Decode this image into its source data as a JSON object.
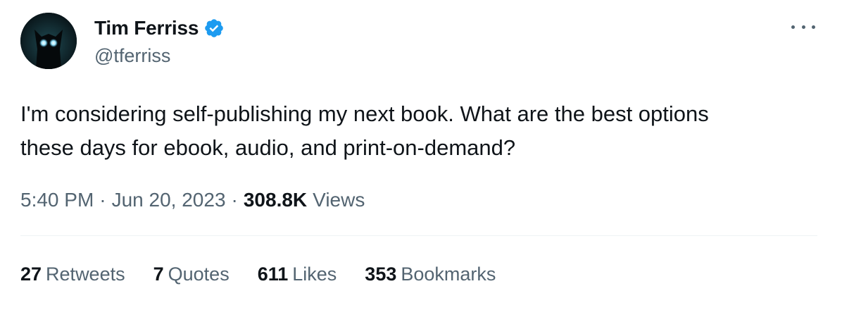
{
  "author": {
    "display_name": "Tim Ferriss",
    "handle": "@tferriss",
    "avatar_icon": "wolf-avatar-icon",
    "verified_icon": "verified-badge-icon"
  },
  "tweet": {
    "text": "I'm considering self-publishing my next book. What are the best options\nthese days for ebook, audio, and print-on-demand?"
  },
  "meta": {
    "time": "5:40 PM",
    "separator": "·",
    "date": "Jun 20, 2023",
    "views_count": "308.8K",
    "views_label": "Views"
  },
  "stats": [
    {
      "count": "27",
      "label": "Retweets"
    },
    {
      "count": "7",
      "label": "Quotes"
    },
    {
      "count": "611",
      "label": "Likes"
    },
    {
      "count": "353",
      "label": "Bookmarks"
    }
  ],
  "colors": {
    "text": "#0f1419",
    "secondary": "#536471",
    "verified": "#1d9bf0",
    "divider": "#eff3f4"
  }
}
